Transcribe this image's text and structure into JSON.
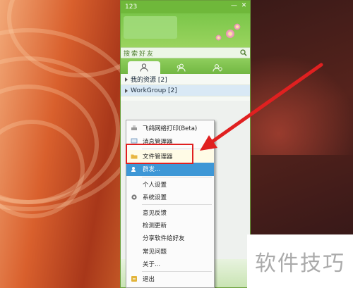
{
  "window": {
    "title": "123",
    "minimize_glyph": "—",
    "close_glyph": "✕"
  },
  "search": {
    "placeholder": "搜索好友"
  },
  "tabs": [
    {
      "name": "contacts-tab",
      "icon": "person-icon"
    },
    {
      "name": "group-tab",
      "icon": "people-icon"
    },
    {
      "name": "recent-tab",
      "icon": "clock-person-icon"
    }
  ],
  "groups": [
    {
      "label": "我的资源 [2]"
    },
    {
      "label": "WorkGroup [2]"
    }
  ],
  "context_menu": {
    "items": [
      {
        "label": "飞鸽网络打印(Beta)",
        "icon": "printer-icon"
      },
      {
        "label": "消息管理器",
        "icon": "message-icon"
      },
      {
        "label": "文件管理器",
        "icon": "folder-icon"
      },
      {
        "label": "群发...",
        "icon": "broadcast-icon"
      },
      {
        "label": "个人设置",
        "icon": ""
      },
      {
        "label": "系统设置",
        "icon": "gear-icon"
      },
      {
        "label": "意见反馈",
        "icon": ""
      },
      {
        "label": "检测更新",
        "icon": ""
      },
      {
        "label": "分享软件给好友",
        "icon": ""
      },
      {
        "label": "常见问题",
        "icon": ""
      },
      {
        "label": "关于...",
        "icon": ""
      },
      {
        "label": "退出",
        "icon": "exit-icon"
      }
    ]
  },
  "watermark": "软件技巧",
  "colors": {
    "window_green": "#6fb83a",
    "highlight_red": "#e02020",
    "menu_hover_blue": "#3e97d6"
  }
}
